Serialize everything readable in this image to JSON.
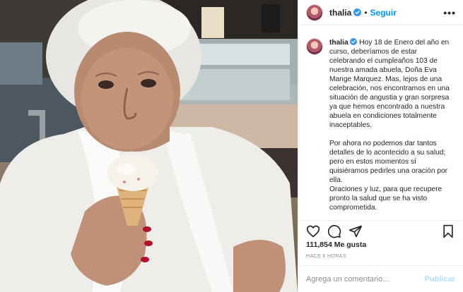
{
  "post": {
    "username": "thalia",
    "verified": true,
    "separator": "•",
    "follow_label": "Seguir",
    "more_label": "•••"
  },
  "caption": {
    "username": "thalia",
    "text": "Hoy 18 de Enero del año en curso, deberíamos de estar celebrando el cumpleaños 103 de nuestra amada abuela, Doña Eva Mange Marquez. Mas, lejos de una celebración, nos encontramos en una situación de angustia y gran sorpresa ya que hemos encontrado a nuestra abuela en condiciones totalmente inaceptables.\n\nPor ahora no podemos dar tantos detalles de lo acontecido a su salud; pero en estos momentos sí quisiéramos pedirles una oración por ella.\nOraciones y luz, para que recupere pronto la salud que se ha visto comprometida.\n\n¡Muchísimas gracias a tod@s por las"
  },
  "stats": {
    "likes_count": "111,854",
    "likes_label": "Me gusta",
    "timestamp": "HACE 6 HORAS"
  },
  "comment": {
    "placeholder": "Agrega un comentario...",
    "post_label": "Publicar"
  },
  "icons": {
    "like": "heart-icon",
    "comment": "comment-icon",
    "share": "share-icon",
    "save": "bookmark-icon",
    "verified": "verified-badge-icon"
  },
  "colors": {
    "follow": "#0095f6",
    "verified": "#3897f0",
    "post_disabled": "#b2dffc",
    "muted": "#8e8e8e"
  }
}
